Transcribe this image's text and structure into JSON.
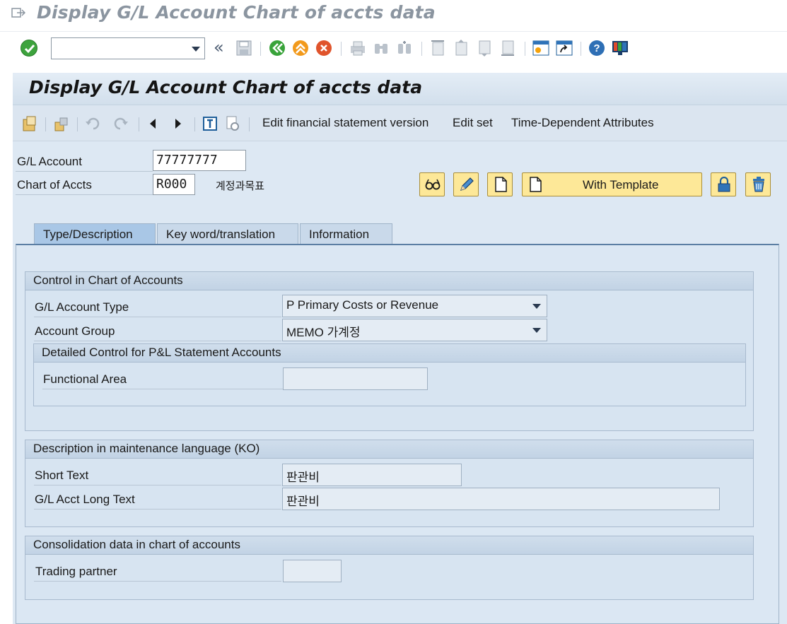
{
  "window": {
    "title": "Display G/L Account Chart of accts data"
  },
  "system_toolbar": {
    "command_placeholder": ""
  },
  "screen": {
    "title": "Display G/L Account Chart of accts data"
  },
  "app_toolbar": {
    "edit_fs_version": "Edit financial statement version",
    "edit_set": "Edit set",
    "time_dependent": "Time-Dependent Attributes"
  },
  "header": {
    "gl_account_label": "G/L Account",
    "gl_account_value": "77777777",
    "chart_label": "Chart of Accts",
    "chart_value": "R000",
    "chart_desc": "계정과목표",
    "with_template": "With Template"
  },
  "tabs": [
    {
      "label": "Type/Description"
    },
    {
      "label": "Key word/translation"
    },
    {
      "label": "Information"
    }
  ],
  "control_group": {
    "title": "Control in Chart of Accounts",
    "account_type_label": "G/L Account Type",
    "account_type_value": "P Primary Costs or Revenue",
    "account_group_label": "Account Group",
    "account_group_value": "MEMO 가계정",
    "pl_group_title": "Detailed Control for P&L Statement Accounts",
    "functional_area_label": "Functional Area",
    "functional_area_value": ""
  },
  "description_group": {
    "title": "Description in maintenance language (KO)",
    "short_text_label": "Short Text",
    "short_text_value": "판관비",
    "long_text_label": "G/L Acct Long Text",
    "long_text_value": "판관비"
  },
  "consolidation_group": {
    "title": "Consolidation data in chart of accounts",
    "trading_partner_label": "Trading partner",
    "trading_partner_value": ""
  }
}
